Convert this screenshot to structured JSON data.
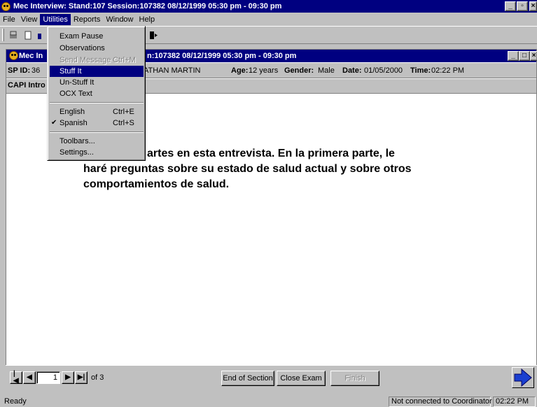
{
  "app": {
    "title": "Mec Interview: Stand:107 Session:107382 08/12/1999 05:30 pm - 09:30 pm"
  },
  "menubar": {
    "items": [
      "File",
      "View",
      "Utilities",
      "Reports",
      "Window",
      "Help"
    ],
    "active": "Utilities"
  },
  "utilities_menu": {
    "exam_pause": "Exam Pause",
    "observations": "Observations",
    "send_message": "Send Message",
    "send_message_shortcut": "Ctrl+M",
    "stuff_it": "Stuff It",
    "un_stuff_it": "Un-Stuff It",
    "ocx_text": "OCX Text",
    "english": "English",
    "english_shortcut": "Ctrl+E",
    "spanish": "Spanish",
    "spanish_shortcut": "Ctrl+S",
    "spanish_check": "✔",
    "toolbars": "Toolbars...",
    "settings": "Settings..."
  },
  "child_window": {
    "title_start": "Mec In",
    "title_end": "n:107382 08/12/1999 05:30 pm - 09:30 pm"
  },
  "info": {
    "sp_id_label": "SP ID:",
    "sp_id_value": "36",
    "name_fragment": "ATHAN MARTIN",
    "age_label": "Age:",
    "age_value": "12 years",
    "gender_label": "Gender:",
    "gender_value": "Male",
    "date_label": "Date:",
    "date_value": "01/05/2000",
    "time_label": "Time:",
    "time_value": "02:22 PM"
  },
  "section": {
    "title": "CAPI Intro"
  },
  "question": {
    "line1": "artes en esta entrevista. En la primera parte, le",
    "line2": "haré preguntas sobre su estado de salud actual y sobre otros",
    "line3": "comportamientos de salud."
  },
  "nav": {
    "page": "1",
    "of_label": "of 3",
    "end_of_section": "End of Section",
    "close_exam": "Close Exam",
    "finish": "Finish"
  },
  "status": {
    "ready": "Ready",
    "connection": "Not connected to Coordinator",
    "time": "02:22 PM"
  },
  "colors": {
    "titlebar": "#000080",
    "face": "#c0c0c0",
    "next_arrow": "#1a3fd0"
  }
}
